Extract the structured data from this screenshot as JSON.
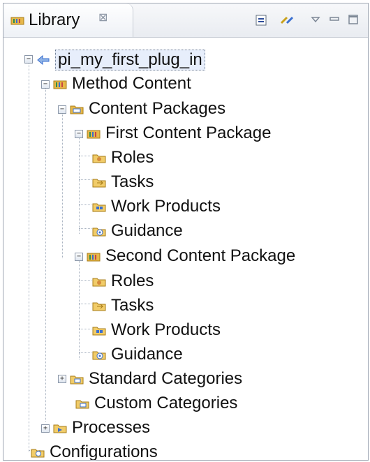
{
  "view": {
    "title": "Library",
    "close_glyph": "⊠",
    "toolbar": {
      "icons": [
        "collapse-all-icon",
        "link-with-editor-icon",
        "view-menu-icon",
        "minimize-icon",
        "maximize-icon"
      ]
    }
  },
  "tree": {
    "root": "pi_my_first_plug_in",
    "method_content": "Method Content",
    "content_packages": "Content Packages",
    "first_package": "First Content Package",
    "second_package": "Second Content Package",
    "roles": "Roles",
    "tasks": "Tasks",
    "work_products": "Work Products",
    "guidance": "Guidance",
    "standard_categories": "Standard Categories",
    "custom_categories": "Custom Categories",
    "processes": "Processes",
    "configurations": "Configurations",
    "toggle_minus": "−",
    "toggle_plus": "+"
  },
  "colors": {
    "folder_yellow": "#e7b84a",
    "method_green": "#2f8f4a",
    "selection_bg": "#e7eefb",
    "icon_blue": "#3a6fd0"
  }
}
